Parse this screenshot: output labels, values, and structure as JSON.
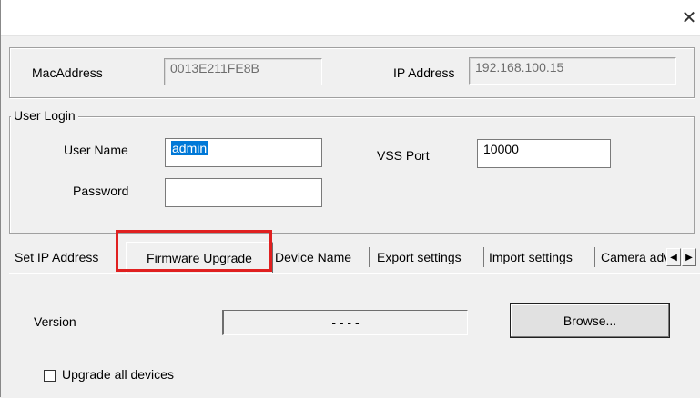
{
  "window": {
    "close_glyph": "✕"
  },
  "device_info": {
    "mac_label": "MacAddress",
    "mac_value": "0013E211FE8B",
    "ip_label": "IP Address",
    "ip_value": "192.168.100.15"
  },
  "user_login": {
    "group_label": "User Login",
    "username_label": "User Name",
    "username_value": "admin",
    "password_label": "Password",
    "password_value": "",
    "vss_port_label": "VSS Port",
    "vss_port_value": "10000"
  },
  "tabs": [
    {
      "label": "Set IP Address",
      "active": false
    },
    {
      "label": "Firmware Upgrade",
      "active": true
    },
    {
      "label": "Device Name",
      "active": false
    },
    {
      "label": "Export settings",
      "active": false
    },
    {
      "label": "Import settings",
      "active": false
    },
    {
      "label": "Camera advanced",
      "active": false
    }
  ],
  "tab_scroll": {
    "left_glyph": "◀",
    "right_glyph": "▶"
  },
  "firmware": {
    "version_label": "Version",
    "version_value": "- - - -",
    "browse_label": "Browse...",
    "upgrade_all_label": "Upgrade all devices",
    "upgrade_all_checked": false
  },
  "colors": {
    "highlight": "#e02020",
    "selection": "#0078d7"
  }
}
